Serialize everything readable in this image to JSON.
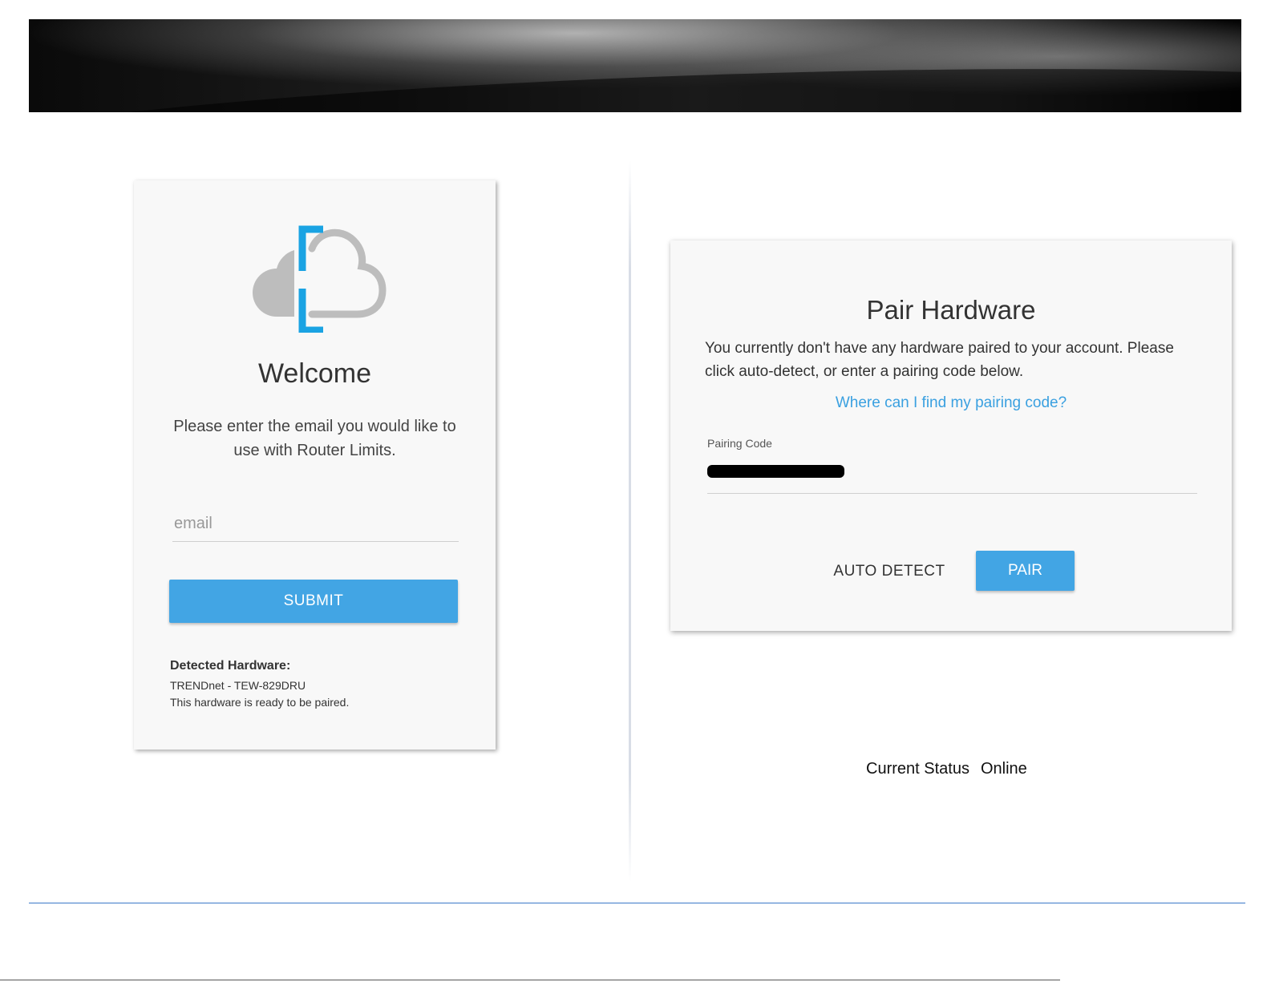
{
  "welcome": {
    "title": "Welcome",
    "text": "Please enter the email you would like to use with Router Limits.",
    "email_placeholder": "email",
    "email_value": "",
    "submit_label": "SUBMIT",
    "detected_title": "Detected Hardware:",
    "detected_model": "TRENDnet - TEW-829DRU",
    "detected_status": "This hardware is ready to be paired."
  },
  "pair": {
    "title": "Pair Hardware",
    "text": "You currently don't have any hardware paired to your account. Please click auto-detect, or enter a pairing code below.",
    "link": "Where can I find my pairing code?",
    "code_label": "Pairing Code",
    "code_value": "●●●●●●●●●●●●●●",
    "auto_detect_label": "AUTO DETECT",
    "pair_label": "PAIR"
  },
  "status": {
    "label": "Current Status",
    "value": "Online"
  },
  "colors": {
    "accent": "#42a5e4",
    "link": "#3aa0e0",
    "logo_blue": "#1aa3e3",
    "logo_gray": "#bdbdbd"
  }
}
